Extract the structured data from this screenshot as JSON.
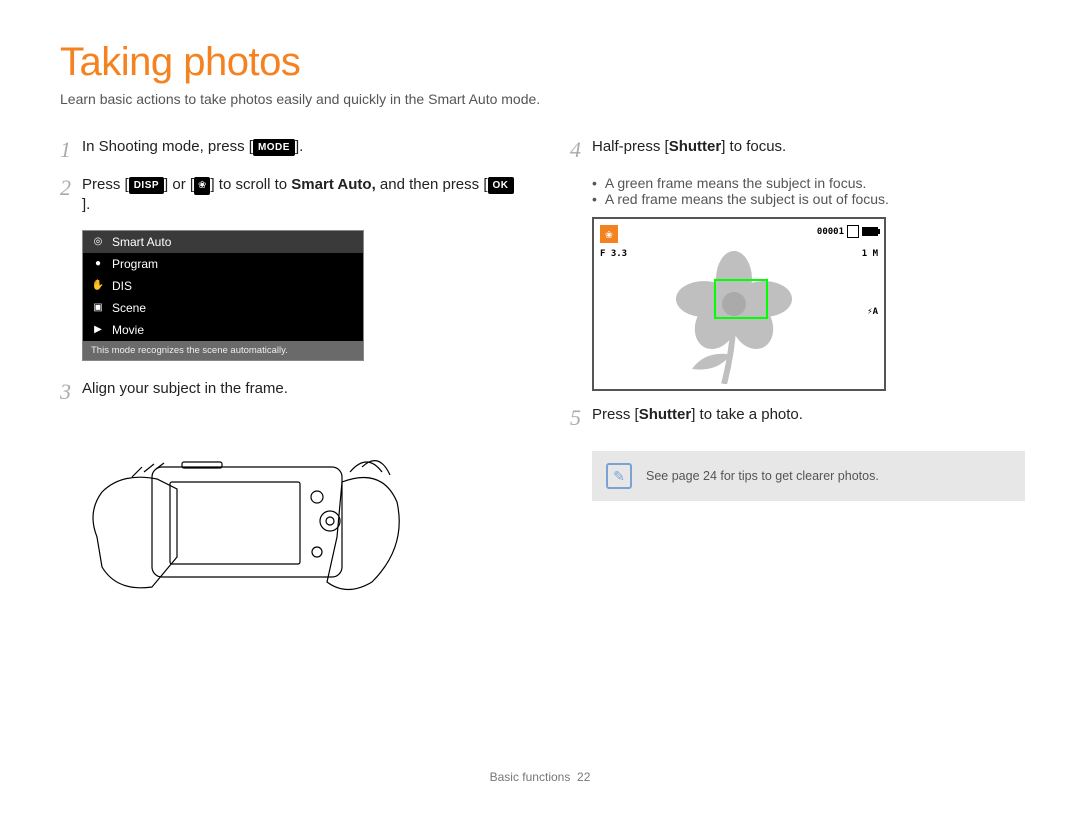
{
  "title": "Taking photos",
  "intro": "Learn basic actions to take photos easily and quickly in the Smart Auto mode.",
  "labels": {
    "mode": "MODE",
    "disp": "DISP",
    "ok": "OK",
    "shutter": "Shutter"
  },
  "left": {
    "step1_num": "1",
    "step1_pre": "In Shooting mode, press [",
    "step1_post": "].",
    "step2_num": "2",
    "step2_a": "Press [",
    "step2_b": "] or [",
    "step2_c": "] to scroll to ",
    "step2_label": "Smart Auto,",
    "step2_d": " and then press [",
    "step2_e": "].",
    "step3_num": "3",
    "step3_text": "Align your subject in the frame."
  },
  "menu": {
    "items": [
      {
        "icon": "◎",
        "label": "Smart Auto",
        "selected": true
      },
      {
        "icon": "●",
        "label": "Program"
      },
      {
        "icon": "✋",
        "label": "DIS"
      },
      {
        "icon": "▣",
        "label": "Scene"
      },
      {
        "icon": "▶",
        "label": "Movie"
      }
    ],
    "hint": "This mode recognizes the scene automatically."
  },
  "right": {
    "step4_num": "4",
    "step4_a": "Half-press [",
    "step4_b": "] to focus.",
    "bullets": [
      "A green frame means the subject in focus.",
      "A red frame means the subject is out of focus."
    ],
    "step5_num": "5",
    "step5_a": "Press [",
    "step5_b": "] to take a photo."
  },
  "preview": {
    "aperture": "F 3.3",
    "counter": "00001",
    "size": "1 M",
    "flash": "⚡A",
    "macro": "❀"
  },
  "tip": "See page 24 for tips to get clearer photos.",
  "footer_section": "Basic functions",
  "footer_page": "22"
}
